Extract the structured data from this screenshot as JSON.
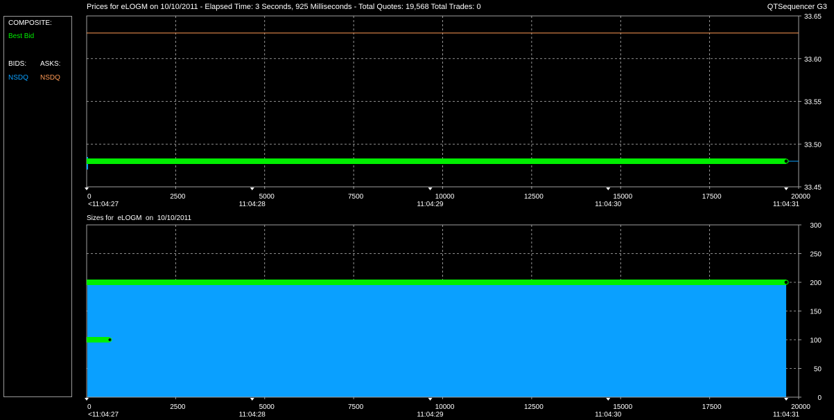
{
  "header": {
    "title": "Prices for  eLOGM  on  10/10/2011  -  Elapsed Time: 3 Seconds, 925 Milliseconds  -  Total Quotes: 19,568  Total Trades: 0",
    "app_name": "QTSequencer G3"
  },
  "legend": {
    "composite_label": "COMPOSITE:",
    "best_bid_label": "Best Bid",
    "bids_label": "BIDS:",
    "asks_label": "ASKS:",
    "bid_exchange": "NSDQ",
    "ask_exchange": "NSDQ"
  },
  "colors": {
    "best_bid": "#00ee00",
    "bid": "#0aa0ff",
    "ask": "#ff9a55",
    "grid": "#bbbbbb",
    "frame": "#a0a0a0"
  },
  "chart_data": [
    {
      "type": "line",
      "title": "Prices for  eLOGM  on  10/10/2011",
      "xlim": [
        0,
        20000
      ],
      "ylim": [
        33.45,
        33.65
      ],
      "xticks": [
        0,
        2500,
        5000,
        7500,
        10000,
        12500,
        15000,
        17500,
        20000
      ],
      "yticks": [
        33.45,
        33.5,
        33.55,
        33.6,
        33.65
      ],
      "ytick_labels": [
        "33.45",
        "33.50",
        "33.55",
        "33.60",
        "33.65"
      ],
      "time_ticks": [
        {
          "x": 0,
          "label": "<11:04:27"
        },
        {
          "x": 4650,
          "label": "11:04:28"
        },
        {
          "x": 9650,
          "label": "11:04:29"
        },
        {
          "x": 14650,
          "label": "11:04:30"
        },
        {
          "x": 19650,
          "label": "11:04:31"
        }
      ],
      "grid": true,
      "series": [
        {
          "name": "ASKS: NSDQ",
          "x": [
            0,
            20000
          ],
          "y": [
            33.63,
            33.63
          ]
        },
        {
          "name": "BIDS: NSDQ",
          "x": [
            0,
            20000
          ],
          "y": [
            33.48,
            33.48
          ]
        },
        {
          "name": "Best Bid",
          "x": [
            0,
            19650
          ],
          "y": [
            33.48,
            33.48
          ]
        }
      ]
    },
    {
      "type": "area",
      "title": "Sizes for  eLOGM  on  10/10/2011",
      "xlim": [
        0,
        20000
      ],
      "ylim": [
        0,
        300
      ],
      "xticks": [
        0,
        2500,
        5000,
        7500,
        10000,
        12500,
        15000,
        17500,
        20000
      ],
      "yticks": [
        0,
        50,
        100,
        150,
        200,
        250,
        300
      ],
      "ytick_labels": [
        "0",
        "50",
        "100",
        "150",
        "200",
        "250",
        "300"
      ],
      "time_ticks": [
        {
          "x": 0,
          "label": "<11:04:27"
        },
        {
          "x": 4650,
          "label": "11:04:28"
        },
        {
          "x": 9650,
          "label": "11:04:29"
        },
        {
          "x": 14650,
          "label": "11:04:30"
        },
        {
          "x": 19650,
          "label": "11:04:31"
        }
      ],
      "grid": true,
      "series": [
        {
          "name": "BIDS: NSDQ",
          "x": [
            0,
            19650
          ],
          "y": [
            200,
            200
          ]
        },
        {
          "name": "Best Bid",
          "x": [
            0,
            19650
          ],
          "y": [
            200,
            200
          ]
        },
        {
          "name": "Best Bid",
          "x": [
            0,
            650
          ],
          "y": [
            100,
            100
          ]
        }
      ]
    }
  ]
}
